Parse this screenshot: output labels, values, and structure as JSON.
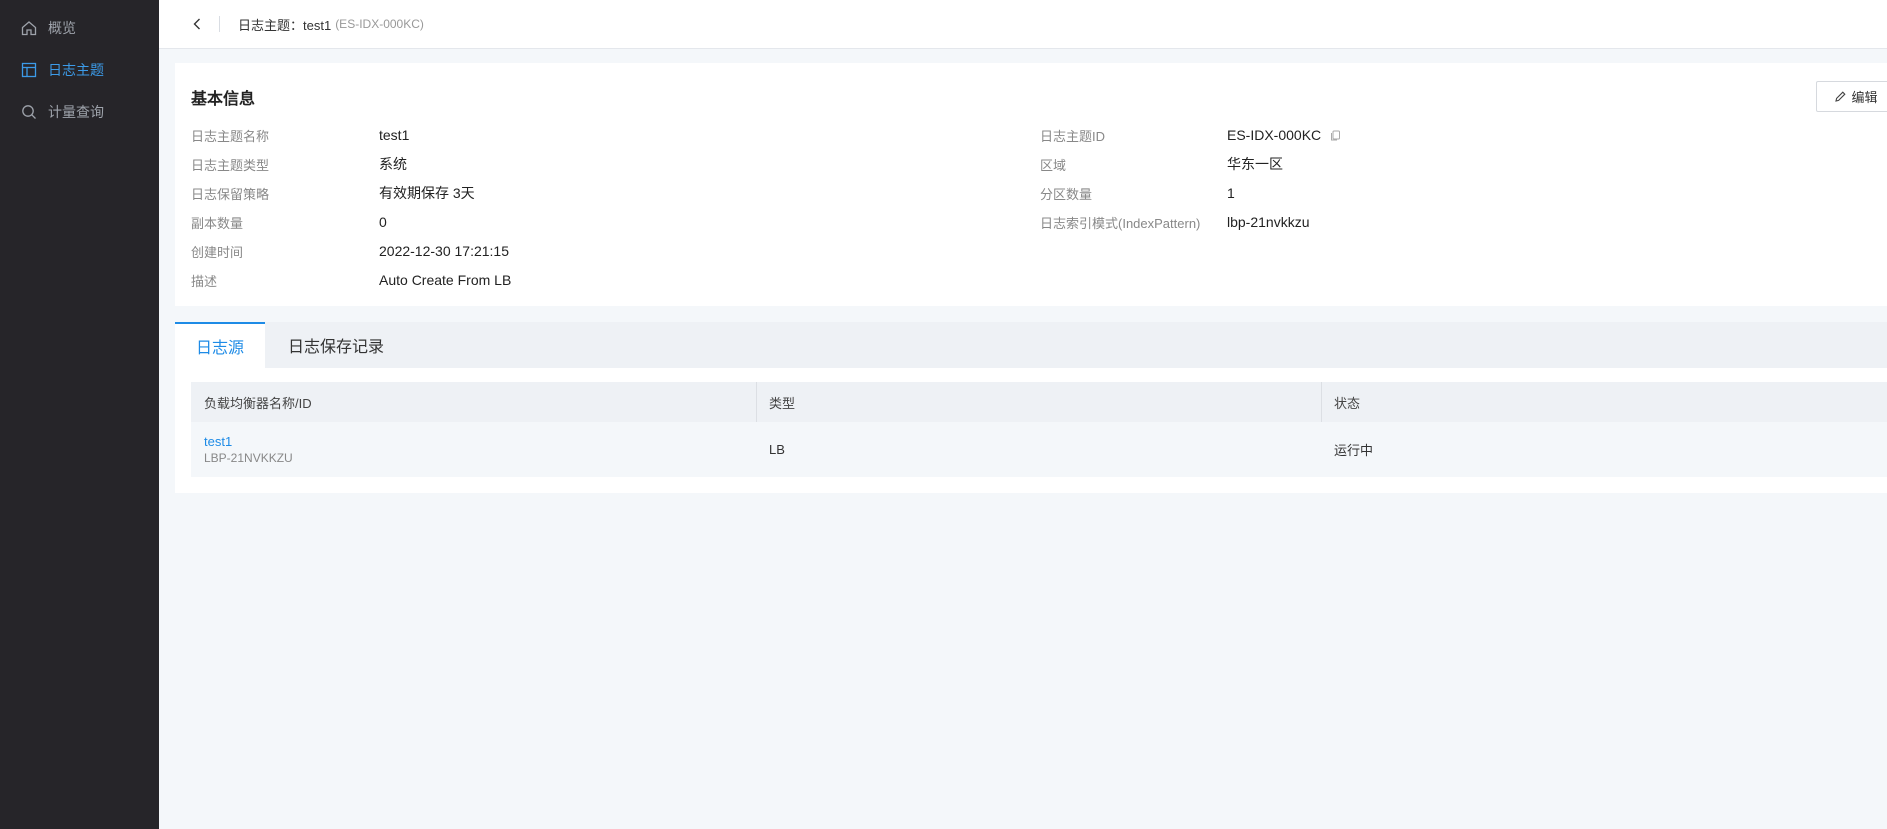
{
  "sidebar": {
    "items": [
      {
        "label": "概览",
        "icon": "home-icon",
        "active": false
      },
      {
        "label": "日志主题",
        "icon": "layout-icon",
        "active": true
      },
      {
        "label": "计量查询",
        "icon": "search-icon",
        "active": false
      }
    ]
  },
  "header": {
    "title": "日志主题：test1",
    "id": "(ES-IDX-000KC)"
  },
  "basic_info": {
    "title": "基本信息",
    "edit_label": "编辑",
    "left": [
      {
        "label": "日志主题名称",
        "value": "test1"
      },
      {
        "label": "日志主题类型",
        "value": "系统"
      },
      {
        "label": "日志保留策略",
        "value": "有效期保存 3天"
      },
      {
        "label": "副本数量",
        "value": "0"
      },
      {
        "label": "创建时间",
        "value": "2022-12-30 17:21:15"
      },
      {
        "label": "描述",
        "value": "Auto Create From LB"
      }
    ],
    "right": [
      {
        "label": "日志主题ID",
        "value": "ES-IDX-000KC"
      },
      {
        "label": "区域",
        "value": "华东一区"
      },
      {
        "label": "分区数量",
        "value": "1"
      },
      {
        "label": "日志索引模式(IndexPattern)",
        "value": "lbp-21nvkkzu"
      }
    ]
  },
  "tabs": [
    {
      "label": "日志源",
      "active": true
    },
    {
      "label": "日志保存记录",
      "active": false
    }
  ],
  "table": {
    "columns": [
      "负载均衡器名称/ID",
      "类型",
      "状态"
    ],
    "rows": [
      {
        "name": "test1",
        "id": "LBP-21NVKKZU",
        "type": "LB",
        "status": "运行中"
      }
    ]
  },
  "colors": {
    "sidebar_bg": "#262529",
    "accent": "#1e8be6",
    "page_bg": "#f4f7fa"
  }
}
